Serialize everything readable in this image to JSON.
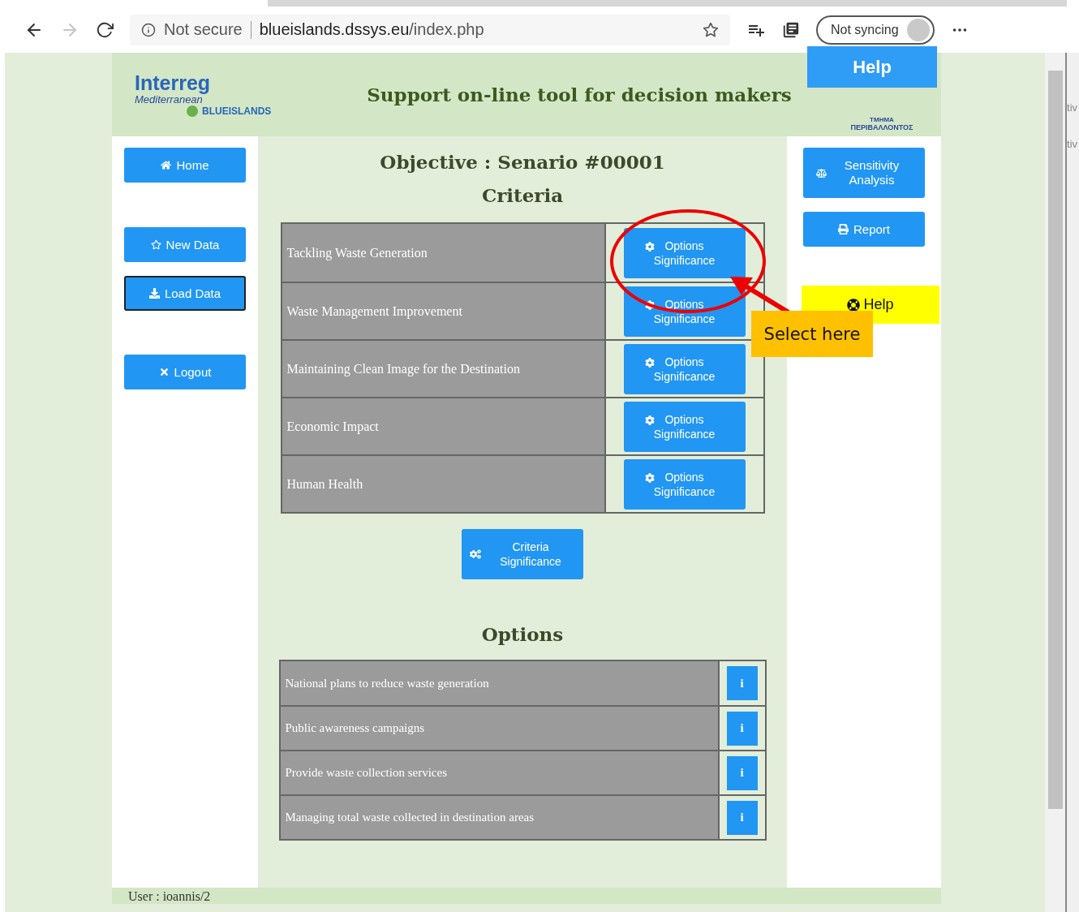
{
  "browser": {
    "security": "Not secure",
    "host": "blueislands.dssys.eu",
    "path": "/index.php",
    "sync": "Not syncing"
  },
  "header": {
    "logo_name": "Interreg",
    "logo_region": "Mediterranean",
    "logo_project": "BLUEISLANDS",
    "title": "Support on-line tool for decision makers",
    "partner_line_1": "ΤΜΗΜΑ",
    "partner_line_2": "ΠΕΡΙΒΑΛΛΟΝΤΟΣ"
  },
  "help_banner": "Help",
  "left_nav": [
    {
      "label": "Home",
      "focused": false
    },
    {
      "label": "New Data",
      "focused": false
    },
    {
      "label": "Load Data",
      "focused": true
    },
    {
      "label": "Logout",
      "focused": false
    }
  ],
  "objective": "Objective : Senario #00001",
  "criteria_heading": "Criteria",
  "criteria": [
    {
      "label": "Tackling Waste Generation",
      "button": "Options Significance"
    },
    {
      "label": "Waste Management Improvement",
      "button": "Options Significance"
    },
    {
      "label": "Maintaining Clean Image for the Destination",
      "button": "Options Significance"
    },
    {
      "label": "Economic Impact",
      "button": "Options Significance"
    },
    {
      "label": "Human Health",
      "button": "Options Significance"
    }
  ],
  "criteria_button": "Criteria Significance",
  "options_heading": "Options",
  "options": [
    {
      "label": "National plans to reduce waste generation",
      "button": "i"
    },
    {
      "label": "Public awareness campaigns",
      "button": "i"
    },
    {
      "label": "Provide waste collection services",
      "button": "i"
    },
    {
      "label": "Managing total waste collected in destination areas",
      "button": "i"
    }
  ],
  "right_nav": [
    {
      "label": "Sensitivity Analysis"
    },
    {
      "label": "Report"
    }
  ],
  "help_box": {
    "label": "Help"
  },
  "callout": "Select here",
  "footer": "User : ioannis/2",
  "edge_fragments": [
    "tiv",
    "tiv"
  ]
}
